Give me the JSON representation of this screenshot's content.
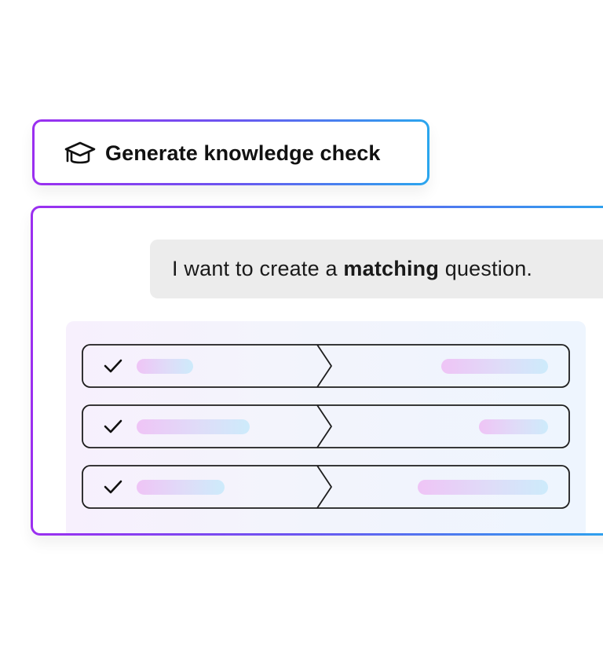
{
  "generate_button": {
    "label": "Generate knowledge check",
    "icon": "graduation-cap-icon"
  },
  "chat": {
    "text_before": "I want to create a ",
    "text_bold": "matching",
    "text_after": " question."
  },
  "matching_rows": [
    {
      "checked": true,
      "icon": "check-icon"
    },
    {
      "checked": true,
      "icon": "check-icon"
    },
    {
      "checked": true,
      "icon": "check-icon"
    }
  ],
  "colors": {
    "border_gradient_start": "#9b2ff0",
    "border_gradient_mid": "#6b55f0",
    "border_gradient_end": "#2aa6ee",
    "bubble_background": "#ececec",
    "pill_gradient_start": "#efc4f6",
    "pill_gradient_end": "#cdebfb"
  }
}
